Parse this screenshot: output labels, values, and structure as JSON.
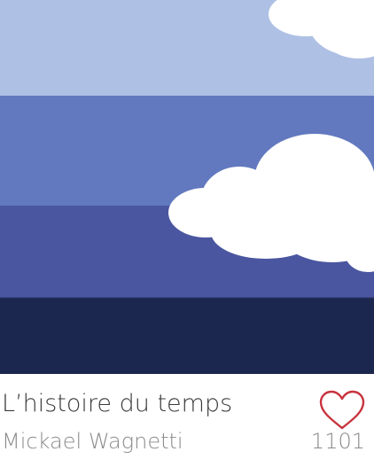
{
  "item": {
    "title": "L’histoire du temps",
    "author": "Mickael Wagnetti",
    "like_count": "1101"
  },
  "icons": {
    "like": "heart-outline-icon"
  },
  "colors": {
    "sky_top": "#aec0e4",
    "sky_mid": "#6279bf",
    "sky_low": "#4a56a0",
    "ground": "#1c2750",
    "cloud": "#ffffff",
    "heart": "#c8343e",
    "title_text": "#3a3a3a",
    "secondary_text": "#8a8a8a"
  }
}
